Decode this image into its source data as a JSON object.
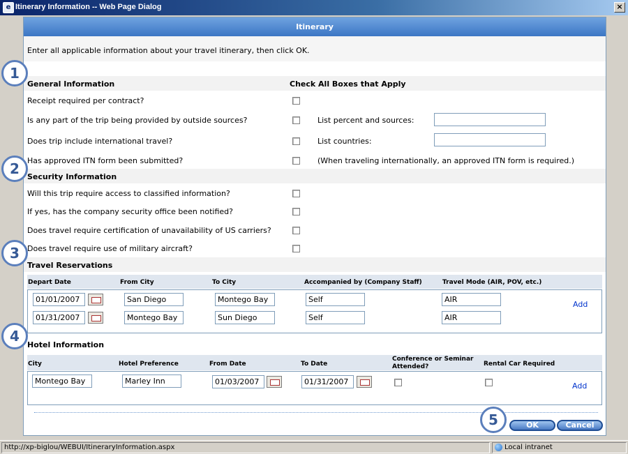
{
  "window": {
    "title": "Itinerary Information -- Web Page Dialog",
    "close_glyph": "×"
  },
  "header": {
    "title": "Itinerary"
  },
  "intro": "Enter all applicable information about your travel itinerary, then click OK.",
  "callouts": [
    "1",
    "2",
    "3",
    "4",
    "5"
  ],
  "general": {
    "heading": "General Information",
    "check_heading": "Check All Boxes that Apply",
    "rows": [
      {
        "question": "Receipt required per contract?"
      },
      {
        "question": "Is any part of the trip being provided by outside sources?",
        "extra_label": "List percent and sources:",
        "extra_value": ""
      },
      {
        "question": "Does trip include international travel?",
        "extra_label": "List countries:",
        "extra_value": ""
      },
      {
        "question": "Has approved ITN form been submitted?",
        "note": "(When traveling internationally, an approved ITN form is required.)"
      }
    ]
  },
  "security": {
    "heading": "Security Information",
    "rows": [
      {
        "question": "Will this trip require access to classified information?"
      },
      {
        "question": "If yes, has the company security office been notified?"
      },
      {
        "question": "Does travel require certification of unavailability of US carriers?"
      },
      {
        "question": "Does travel require use of military aircraft?"
      }
    ]
  },
  "travel": {
    "heading": "Travel Reservations",
    "columns": [
      "Depart Date",
      "From City",
      "To City",
      "Accompanied by (Company Staff)",
      "Travel Mode (AIR, POV, etc.)"
    ],
    "rows": [
      {
        "depart": "01/01/2007",
        "from": "San Diego",
        "to": "Montego Bay",
        "accompanied": "Self",
        "mode": "AIR"
      },
      {
        "depart": "01/31/2007",
        "from": "Montego Bay",
        "to": "Sun Diego",
        "accompanied": "Self",
        "mode": "AIR"
      }
    ],
    "add_label": "Add"
  },
  "hotel": {
    "heading": "Hotel Information",
    "columns": [
      "City",
      "Hotel Preference",
      "From Date",
      "To Date",
      "Conference or Seminar Attended?",
      "Rental Car Required"
    ],
    "row": {
      "city": "Montego Bay",
      "hotel": "Marley Inn",
      "from_date": "01/03/2007",
      "to_date": "01/31/2007"
    },
    "add_label": "Add"
  },
  "buttons": {
    "ok": "OK",
    "cancel": "Cancel"
  },
  "status": {
    "url": "http://xp-biglou/WEBUI/ItineraryInformation.aspx",
    "zone": "Local intranet"
  }
}
